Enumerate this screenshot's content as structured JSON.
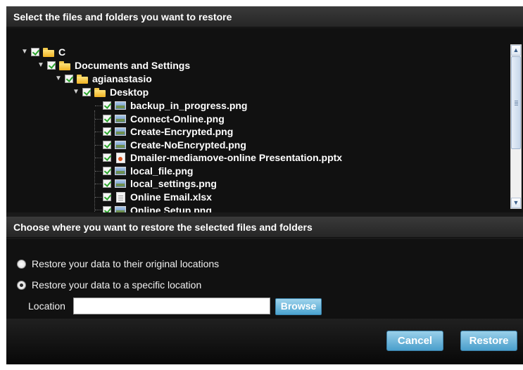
{
  "header_files": "Select the files and folders you want to restore",
  "header_restore": "Choose where you want to restore the selected files and folders",
  "tree": {
    "drive": "C",
    "docs": "Documents and Settings",
    "user": "agianastasio",
    "desktop": "Desktop",
    "files": [
      {
        "name": "backup_in_progress.png",
        "icon": "image-file-icon"
      },
      {
        "name": "Connect-Online.png",
        "icon": "image-file-icon"
      },
      {
        "name": "Create-Encrypted.png",
        "icon": "image-file-icon"
      },
      {
        "name": "Create-NoEncrypted.png",
        "icon": "image-file-icon"
      },
      {
        "name": "Dmailer-mediamove-online Presentation.pptx",
        "icon": "powerpoint-file-icon"
      },
      {
        "name": "local_file.png",
        "icon": "image-file-icon"
      },
      {
        "name": "local_settings.png",
        "icon": "image-file-icon"
      },
      {
        "name": "Online Email.xlsx",
        "icon": "excel-file-icon"
      },
      {
        "name": "Online Setup.png",
        "icon": "image-file-icon"
      }
    ]
  },
  "options": {
    "original": "Restore your data to their original locations",
    "specific": "Restore your data to a specific location",
    "selected": "specific",
    "location_label": "Location",
    "location_value": "",
    "browse": "Browse"
  },
  "buttons": {
    "cancel": "Cancel",
    "restore": "Restore"
  }
}
